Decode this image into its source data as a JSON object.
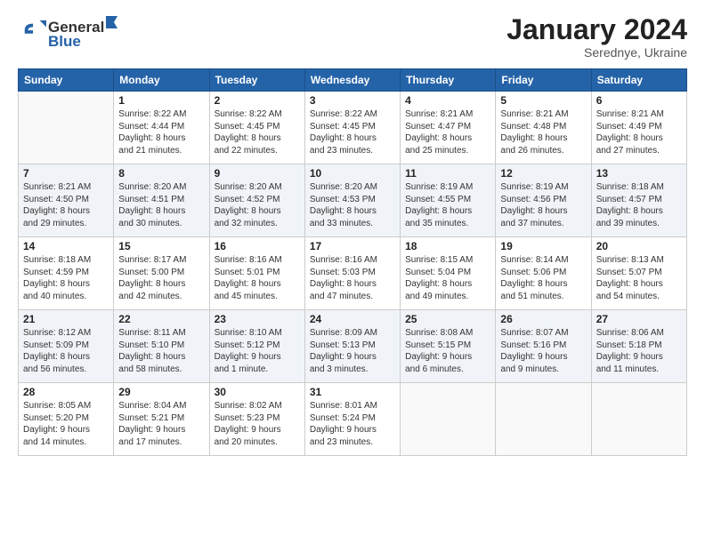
{
  "header": {
    "logo_general": "General",
    "logo_blue": "Blue",
    "month_title": "January 2024",
    "location": "Serednye, Ukraine"
  },
  "days_of_week": [
    "Sunday",
    "Monday",
    "Tuesday",
    "Wednesday",
    "Thursday",
    "Friday",
    "Saturday"
  ],
  "weeks": [
    {
      "alt": false,
      "days": [
        {
          "num": "",
          "sunrise": "",
          "sunset": "",
          "daylight": ""
        },
        {
          "num": "1",
          "sunrise": "Sunrise: 8:22 AM",
          "sunset": "Sunset: 4:44 PM",
          "daylight": "Daylight: 8 hours and 21 minutes."
        },
        {
          "num": "2",
          "sunrise": "Sunrise: 8:22 AM",
          "sunset": "Sunset: 4:45 PM",
          "daylight": "Daylight: 8 hours and 22 minutes."
        },
        {
          "num": "3",
          "sunrise": "Sunrise: 8:22 AM",
          "sunset": "Sunset: 4:45 PM",
          "daylight": "Daylight: 8 hours and 23 minutes."
        },
        {
          "num": "4",
          "sunrise": "Sunrise: 8:21 AM",
          "sunset": "Sunset: 4:47 PM",
          "daylight": "Daylight: 8 hours and 25 minutes."
        },
        {
          "num": "5",
          "sunrise": "Sunrise: 8:21 AM",
          "sunset": "Sunset: 4:48 PM",
          "daylight": "Daylight: 8 hours and 26 minutes."
        },
        {
          "num": "6",
          "sunrise": "Sunrise: 8:21 AM",
          "sunset": "Sunset: 4:49 PM",
          "daylight": "Daylight: 8 hours and 27 minutes."
        }
      ]
    },
    {
      "alt": true,
      "days": [
        {
          "num": "7",
          "sunrise": "Sunrise: 8:21 AM",
          "sunset": "Sunset: 4:50 PM",
          "daylight": "Daylight: 8 hours and 29 minutes."
        },
        {
          "num": "8",
          "sunrise": "Sunrise: 8:20 AM",
          "sunset": "Sunset: 4:51 PM",
          "daylight": "Daylight: 8 hours and 30 minutes."
        },
        {
          "num": "9",
          "sunrise": "Sunrise: 8:20 AM",
          "sunset": "Sunset: 4:52 PM",
          "daylight": "Daylight: 8 hours and 32 minutes."
        },
        {
          "num": "10",
          "sunrise": "Sunrise: 8:20 AM",
          "sunset": "Sunset: 4:53 PM",
          "daylight": "Daylight: 8 hours and 33 minutes."
        },
        {
          "num": "11",
          "sunrise": "Sunrise: 8:19 AM",
          "sunset": "Sunset: 4:55 PM",
          "daylight": "Daylight: 8 hours and 35 minutes."
        },
        {
          "num": "12",
          "sunrise": "Sunrise: 8:19 AM",
          "sunset": "Sunset: 4:56 PM",
          "daylight": "Daylight: 8 hours and 37 minutes."
        },
        {
          "num": "13",
          "sunrise": "Sunrise: 8:18 AM",
          "sunset": "Sunset: 4:57 PM",
          "daylight": "Daylight: 8 hours and 39 minutes."
        }
      ]
    },
    {
      "alt": false,
      "days": [
        {
          "num": "14",
          "sunrise": "Sunrise: 8:18 AM",
          "sunset": "Sunset: 4:59 PM",
          "daylight": "Daylight: 8 hours and 40 minutes."
        },
        {
          "num": "15",
          "sunrise": "Sunrise: 8:17 AM",
          "sunset": "Sunset: 5:00 PM",
          "daylight": "Daylight: 8 hours and 42 minutes."
        },
        {
          "num": "16",
          "sunrise": "Sunrise: 8:16 AM",
          "sunset": "Sunset: 5:01 PM",
          "daylight": "Daylight: 8 hours and 45 minutes."
        },
        {
          "num": "17",
          "sunrise": "Sunrise: 8:16 AM",
          "sunset": "Sunset: 5:03 PM",
          "daylight": "Daylight: 8 hours and 47 minutes."
        },
        {
          "num": "18",
          "sunrise": "Sunrise: 8:15 AM",
          "sunset": "Sunset: 5:04 PM",
          "daylight": "Daylight: 8 hours and 49 minutes."
        },
        {
          "num": "19",
          "sunrise": "Sunrise: 8:14 AM",
          "sunset": "Sunset: 5:06 PM",
          "daylight": "Daylight: 8 hours and 51 minutes."
        },
        {
          "num": "20",
          "sunrise": "Sunrise: 8:13 AM",
          "sunset": "Sunset: 5:07 PM",
          "daylight": "Daylight: 8 hours and 54 minutes."
        }
      ]
    },
    {
      "alt": true,
      "days": [
        {
          "num": "21",
          "sunrise": "Sunrise: 8:12 AM",
          "sunset": "Sunset: 5:09 PM",
          "daylight": "Daylight: 8 hours and 56 minutes."
        },
        {
          "num": "22",
          "sunrise": "Sunrise: 8:11 AM",
          "sunset": "Sunset: 5:10 PM",
          "daylight": "Daylight: 8 hours and 58 minutes."
        },
        {
          "num": "23",
          "sunrise": "Sunrise: 8:10 AM",
          "sunset": "Sunset: 5:12 PM",
          "daylight": "Daylight: 9 hours and 1 minute."
        },
        {
          "num": "24",
          "sunrise": "Sunrise: 8:09 AM",
          "sunset": "Sunset: 5:13 PM",
          "daylight": "Daylight: 9 hours and 3 minutes."
        },
        {
          "num": "25",
          "sunrise": "Sunrise: 8:08 AM",
          "sunset": "Sunset: 5:15 PM",
          "daylight": "Daylight: 9 hours and 6 minutes."
        },
        {
          "num": "26",
          "sunrise": "Sunrise: 8:07 AM",
          "sunset": "Sunset: 5:16 PM",
          "daylight": "Daylight: 9 hours and 9 minutes."
        },
        {
          "num": "27",
          "sunrise": "Sunrise: 8:06 AM",
          "sunset": "Sunset: 5:18 PM",
          "daylight": "Daylight: 9 hours and 11 minutes."
        }
      ]
    },
    {
      "alt": false,
      "days": [
        {
          "num": "28",
          "sunrise": "Sunrise: 8:05 AM",
          "sunset": "Sunset: 5:20 PM",
          "daylight": "Daylight: 9 hours and 14 minutes."
        },
        {
          "num": "29",
          "sunrise": "Sunrise: 8:04 AM",
          "sunset": "Sunset: 5:21 PM",
          "daylight": "Daylight: 9 hours and 17 minutes."
        },
        {
          "num": "30",
          "sunrise": "Sunrise: 8:02 AM",
          "sunset": "Sunset: 5:23 PM",
          "daylight": "Daylight: 9 hours and 20 minutes."
        },
        {
          "num": "31",
          "sunrise": "Sunrise: 8:01 AM",
          "sunset": "Sunset: 5:24 PM",
          "daylight": "Daylight: 9 hours and 23 minutes."
        },
        {
          "num": "",
          "sunrise": "",
          "sunset": "",
          "daylight": ""
        },
        {
          "num": "",
          "sunrise": "",
          "sunset": "",
          "daylight": ""
        },
        {
          "num": "",
          "sunrise": "",
          "sunset": "",
          "daylight": ""
        }
      ]
    }
  ]
}
